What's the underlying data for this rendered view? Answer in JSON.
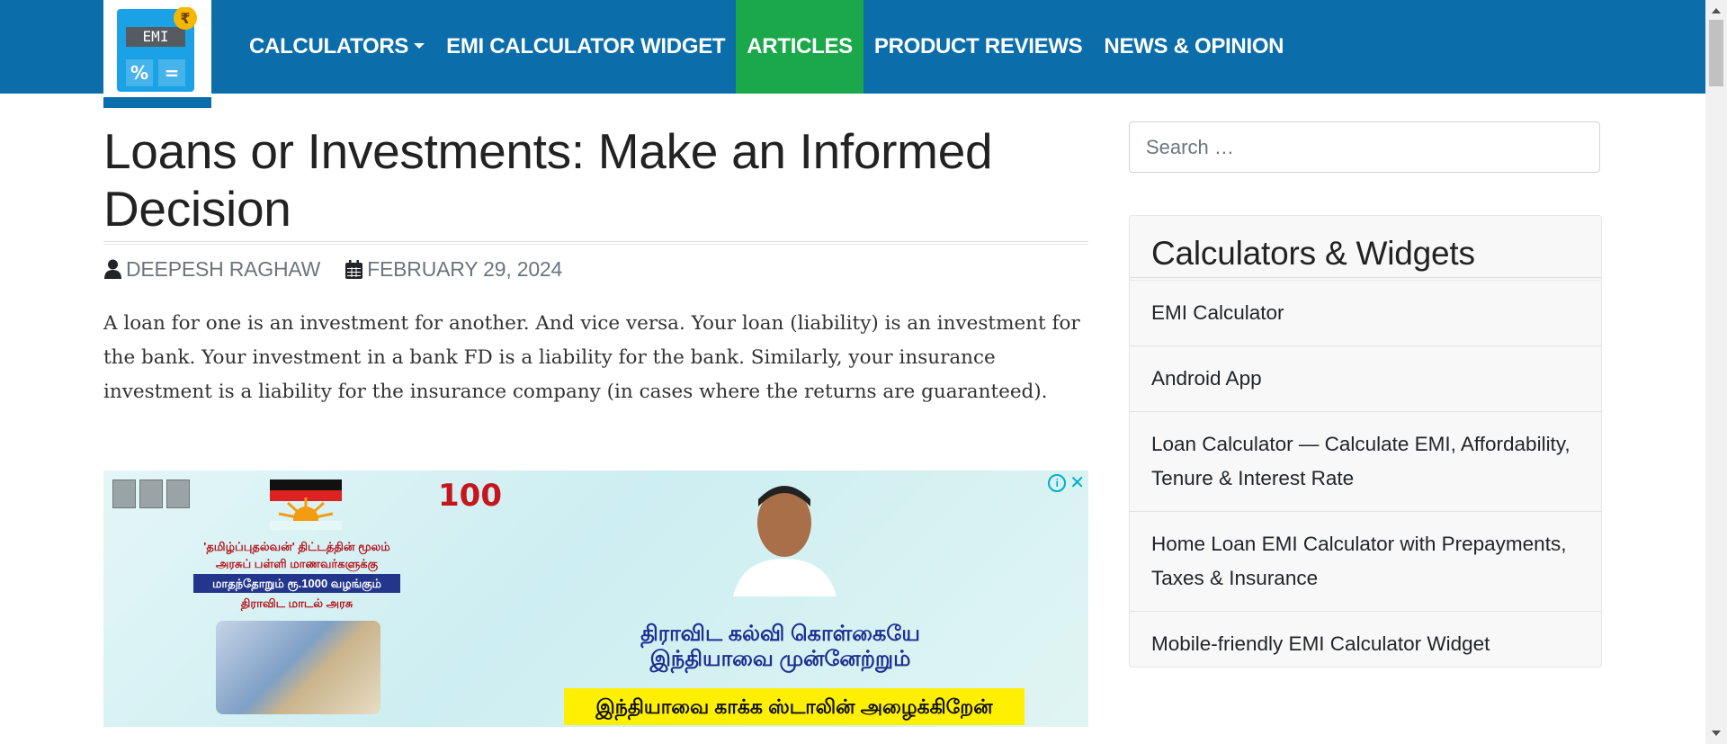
{
  "logo": {
    "screen_text": "EMI",
    "badge_symbol": "₹",
    "keys": [
      "%",
      "="
    ],
    "icon": "emi-calculator-logo-icon"
  },
  "nav": {
    "items": [
      {
        "label": "CALCULATORS",
        "has_dropdown": true
      },
      {
        "label": "EMI CALCULATOR WIDGET"
      },
      {
        "label": "ARTICLES",
        "active": true
      },
      {
        "label": "PRODUCT REVIEWS"
      },
      {
        "label": "NEWS & OPINION"
      }
    ]
  },
  "article": {
    "title": "Loans or Investments: Make an Informed Decision",
    "author": "DEEPESH RAGHAW",
    "date": "FEBRUARY 29, 2024",
    "author_icon": "user-icon",
    "date_icon": "calendar-icon",
    "lead": "A loan for one is an investment for another. And vice versa. Your loan (liability) is an investment for the bank. Your investment in a bank FD is a liability for the bank. Similarly, your insurance investment is a liability for the insurance company (in cases where the returns are guaranteed)."
  },
  "ad": {
    "badge": "100",
    "scheme_lines": [
      "'தமிழ்ப்புதல்வன்' திட்டத்தின் மூலம்",
      "அரசுப் பள்ளி மாணவர்களுக்கு"
    ],
    "scheme_highlight": "மாதந்தோறும் ரூ.1000 வழங்கும்",
    "scheme_footer": "திராவிட மாடல் அரசு",
    "headline_lines": [
      "திராவிட கல்வி கொள்கையே",
      "இந்தியாவை முன்னேற்றும்"
    ],
    "banner": "இந்தியாவை காக்க ஸ்டாலின் அழைக்கிறேன்",
    "info_symbol": "i",
    "close_symbol": "✕"
  },
  "sidebar": {
    "search": {
      "placeholder": "Search …",
      "value": ""
    },
    "widget": {
      "title": "Calculators & Widgets",
      "items": [
        {
          "label": "EMI Calculator"
        },
        {
          "label": "Android App"
        },
        {
          "label": "Loan Calculator — Calculate EMI, Affordability, Tenure & Interest Rate"
        },
        {
          "label": "Home Loan EMI Calculator with Prepayments, Taxes & Insurance"
        },
        {
          "label": "Mobile-friendly EMI Calculator Widget"
        }
      ]
    }
  },
  "colors": {
    "navbar": "#0b6eaa",
    "active_nav": "#1aa84a",
    "logo_blue": "#1aa1e6",
    "badge": "#f5b800",
    "ad_banner": "#fef000"
  }
}
